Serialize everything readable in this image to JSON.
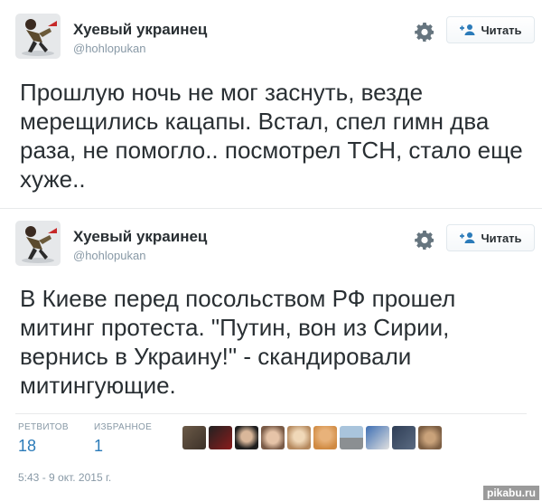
{
  "tweets": [
    {
      "author_name": "Хуевый украинец",
      "author_handle": "@hohlopukan",
      "follow_label": "Читать",
      "text": "Прошлую ночь не мог заснуть, везде мерещились кацапы. Встал, спел гимн два раза, не помогло.. посмотрел ТСН, стало еще хуже.."
    },
    {
      "author_name": "Хуевый украинец",
      "author_handle": "@hohlopukan",
      "follow_label": "Читать",
      "text": "В Киеве перед посольством РФ прошел митинг протеста. \"Путин, вон из Сирии, вернись в Украину!\" - скандировали митингующие."
    }
  ],
  "stats": {
    "retweets_label": "РЕТВИТОВ",
    "retweets_count": "18",
    "favorites_label": "ИЗБРАННОЕ",
    "favorites_count": "1"
  },
  "timestamp": "5:43 - 9 окт. 2015 г.",
  "watermark": "pikabu.ru",
  "colors": {
    "accent": "#2b7bb9",
    "muted": "#8899a6",
    "text": "#292f33"
  },
  "icons": [
    "avatar-image",
    "gear-icon",
    "follow-person-plus-icon",
    "favoriter-face-icon"
  ]
}
